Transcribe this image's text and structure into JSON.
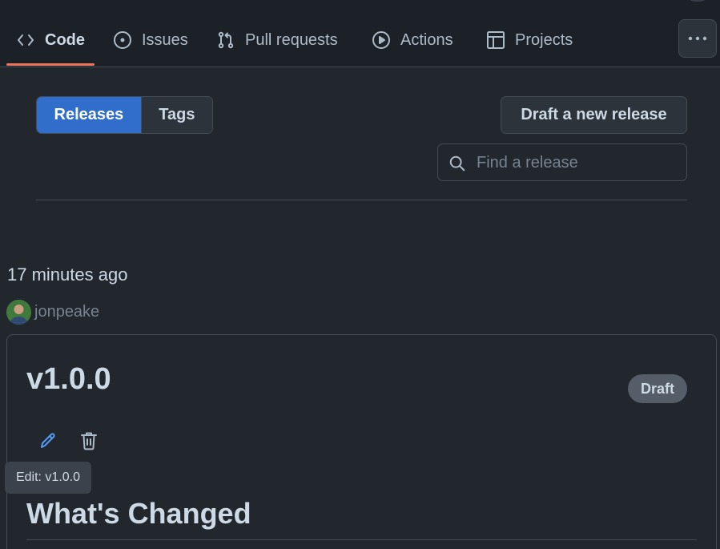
{
  "nav": {
    "tabs": [
      {
        "label": "Code",
        "icon": "code-icon",
        "selected": true
      },
      {
        "label": "Issues",
        "icon": "issue-opened-icon",
        "selected": false
      },
      {
        "label": "Pull requests",
        "icon": "git-pull-request-icon",
        "selected": false
      },
      {
        "label": "Actions",
        "icon": "play-icon",
        "selected": false
      },
      {
        "label": "Projects",
        "icon": "table-icon",
        "selected": false
      }
    ],
    "more_icon": "kebab-horizontal-icon",
    "accent_color": "#ec775c"
  },
  "toolbar": {
    "segments": [
      {
        "label": "Releases",
        "active": true
      },
      {
        "label": "Tags",
        "active": false
      }
    ],
    "draft_button_label": "Draft a new release",
    "search": {
      "placeholder": "Find a release",
      "value": "",
      "icon": "search-icon"
    }
  },
  "release": {
    "time_ago": "17 minutes ago",
    "author": "jonpeake",
    "version": "v1.0.0",
    "badge": "Draft",
    "actions": [
      {
        "icon": "pencil-icon",
        "label": "Edit"
      },
      {
        "icon": "trash-icon",
        "label": "Delete"
      }
    ],
    "tooltip": "Edit: v1.0.0",
    "body_heading": "What's Changed"
  },
  "colors": {
    "background": "#22272e",
    "header_background": "#1c2128",
    "primary_button": "#316dca",
    "edit_icon": "#539bf5",
    "badge_background": "#545d68"
  }
}
